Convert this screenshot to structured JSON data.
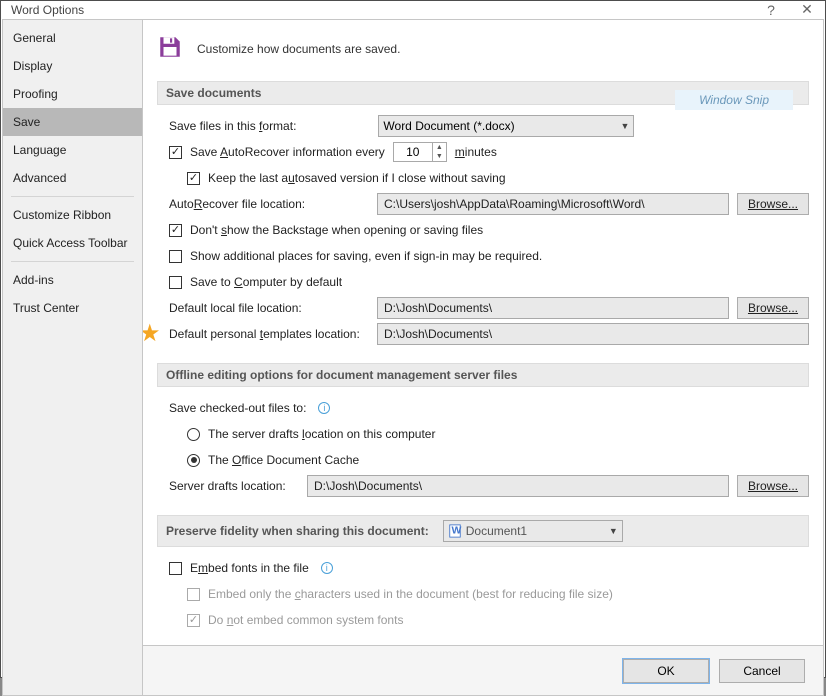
{
  "title": "Word Options",
  "snip_label": "Window Snip",
  "header": "Customize how documents are saved.",
  "sidebar": {
    "items": [
      "General",
      "Display",
      "Proofing",
      "Save",
      "Language",
      "Advanced",
      "Customize Ribbon",
      "Quick Access Toolbar",
      "Add-ins",
      "Trust Center"
    ],
    "active": "Save"
  },
  "sections": {
    "save_documents": "Save documents",
    "offline": "Offline editing options for document management server files",
    "preserve": "Preserve fidelity when sharing this document:"
  },
  "save": {
    "format_label_pre": "Save files in this ",
    "format_label_u": "f",
    "format_label_post": "ormat:",
    "format_value": "Word Document (*.docx)",
    "autorecover_pre": "Save ",
    "autorecover_u": "A",
    "autorecover_post": "utoRecover information every",
    "autorecover_value": "10",
    "autorecover_unit_u": "m",
    "autorecover_unit_post": "inutes",
    "keep_last_pre": "Keep the last a",
    "keep_last_u": "u",
    "keep_last_post": "tosaved version if I close without saving",
    "autorecover_loc_label_pre": "Auto",
    "autorecover_loc_label_u": "R",
    "autorecover_loc_label_post": "ecover file location:",
    "autorecover_loc_value": "C:\\Users\\josh\\AppData\\Roaming\\Microsoft\\Word\\",
    "dont_show_pre": "Don't ",
    "dont_show_u": "s",
    "dont_show_post": "how the Backstage when opening or saving files",
    "show_additional": "Show additional places for saving, even if sign-in may be required.",
    "save_computer_pre": "Save to ",
    "save_computer_u": "C",
    "save_computer_post": "omputer by default",
    "default_local_label": "Default local file location:",
    "default_local_value": "D:\\Josh\\Documents\\",
    "personal_templates_pre": "Default personal ",
    "personal_templates_u": "t",
    "personal_templates_post": "emplates location:",
    "personal_templates_value": "D:\\Josh\\Documents\\",
    "browse_pre": "B",
    "browse_u": "r",
    "browse_post": "owse..."
  },
  "offline": {
    "checked_out_label": "Save checked-out files to:",
    "server_drafts_pre": "The server drafts ",
    "server_drafts_u": "l",
    "server_drafts_post": "ocation on this computer",
    "office_cache_pre": "The ",
    "office_cache_u": "O",
    "office_cache_post": "ffice Document Cache",
    "server_loc_label": "Server drafts location:",
    "server_loc_value": "D:\\Josh\\Documents\\"
  },
  "preserve": {
    "doc_value": "Document1",
    "embed_fonts_pre": "E",
    "embed_fonts_u": "m",
    "embed_fonts_post": "bed fonts in the file",
    "embed_only_pre": "Embed only the ",
    "embed_only_u": "c",
    "embed_only_post": "haracters used in the document (best for reducing file size)",
    "do_not_pre": "Do ",
    "do_not_u": "n",
    "do_not_post": "ot embed common system fonts"
  },
  "footer": {
    "ok": "OK",
    "cancel": "Cancel"
  }
}
